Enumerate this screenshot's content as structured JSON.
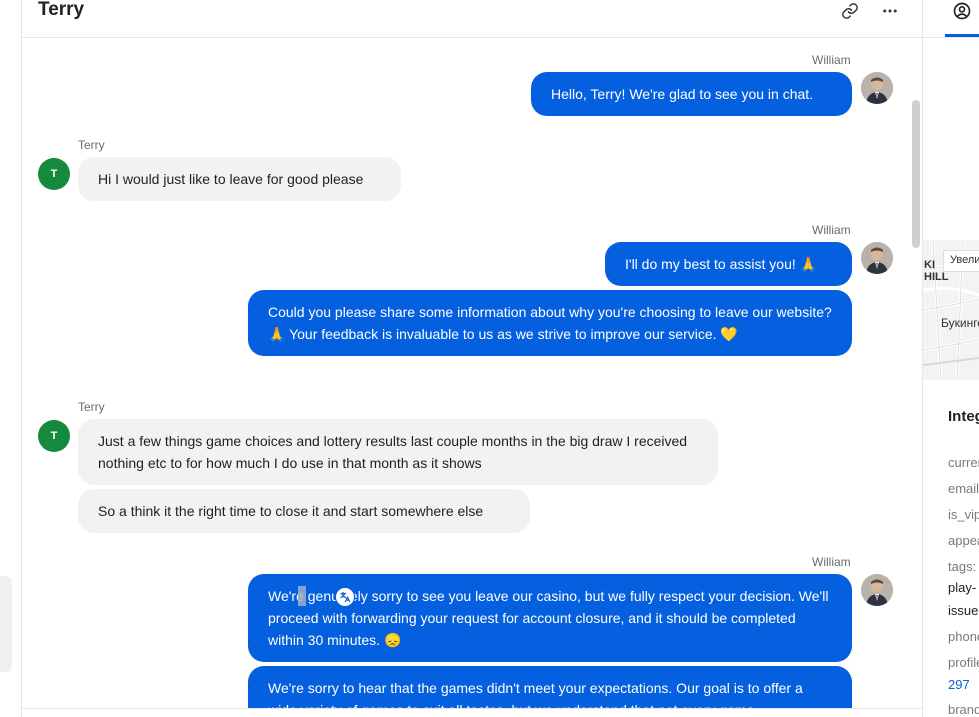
{
  "header": {
    "title": "Terry",
    "link_icon": "link-icon",
    "more_icon": "more-horizontal-icon"
  },
  "messages": [
    {
      "sender": "William",
      "side": "agent",
      "text": "Hello, Terry! We're glad to see you in chat."
    },
    {
      "sender": "Terry",
      "side": "user",
      "text": "Hi I would just like to leave for good please"
    },
    {
      "sender": "William",
      "side": "agent",
      "text": "I'll do my best to assist you! 🙏"
    },
    {
      "sender": "",
      "side": "agent",
      "text": "Could you please share some information about why you're choosing to leave our website? 🙏 Your feedback is invaluable to us as we strive to improve our service. 💛"
    },
    {
      "sender": "Terry",
      "side": "user",
      "text": "Just a few things game choices and lottery results last couple months in the big draw I received nothing etc to for how much I do use in that month as it shows"
    },
    {
      "sender": "",
      "side": "user",
      "text": "So a think it the right time to close it and start somewhere else"
    },
    {
      "sender": "William",
      "side": "agent",
      "text": "We're genuinely sorry to see you leave our casino, but we fully respect your decision. We'll proceed with forwarding your request for account closure, and it should be completed within 30 minutes. 😞"
    },
    {
      "sender": "",
      "side": "agent",
      "text": "We're sorry to hear that the games didn't meet your expectations. Our goal is to offer a wide variety of games to suit all tastes, but we understand that not every game"
    }
  ],
  "avatars": {
    "user_initial": "T"
  },
  "right_panel": {
    "tab_icon": "user-circle-icon",
    "map": {
      "zoom_label": "Увеличить",
      "label_hill_1": "KI",
      "label_hill_2": "HILL",
      "label_street": "Букингем"
    },
    "attributes_heading": "Integrations",
    "attributes": [
      {
        "key": "current",
        "style": "key"
      },
      {
        "key": "email",
        "style": "key"
      },
      {
        "key": "is_vip",
        "style": "key"
      },
      {
        "key": "appearance",
        "style": "key"
      },
      {
        "key": "tags:",
        "style": "key"
      },
      {
        "key": "play-",
        "style": "val"
      },
      {
        "key": "issue",
        "style": "val"
      },
      {
        "key": "phone",
        "style": "key"
      },
      {
        "key": "profile",
        "style": "key"
      },
      {
        "key": "297",
        "style": "link"
      },
      {
        "key": "brand",
        "style": "key"
      }
    ]
  },
  "colors": {
    "accent": "#0560e0",
    "user_bubble": "#f2f2f2",
    "user_avatar": "#168a3c"
  }
}
